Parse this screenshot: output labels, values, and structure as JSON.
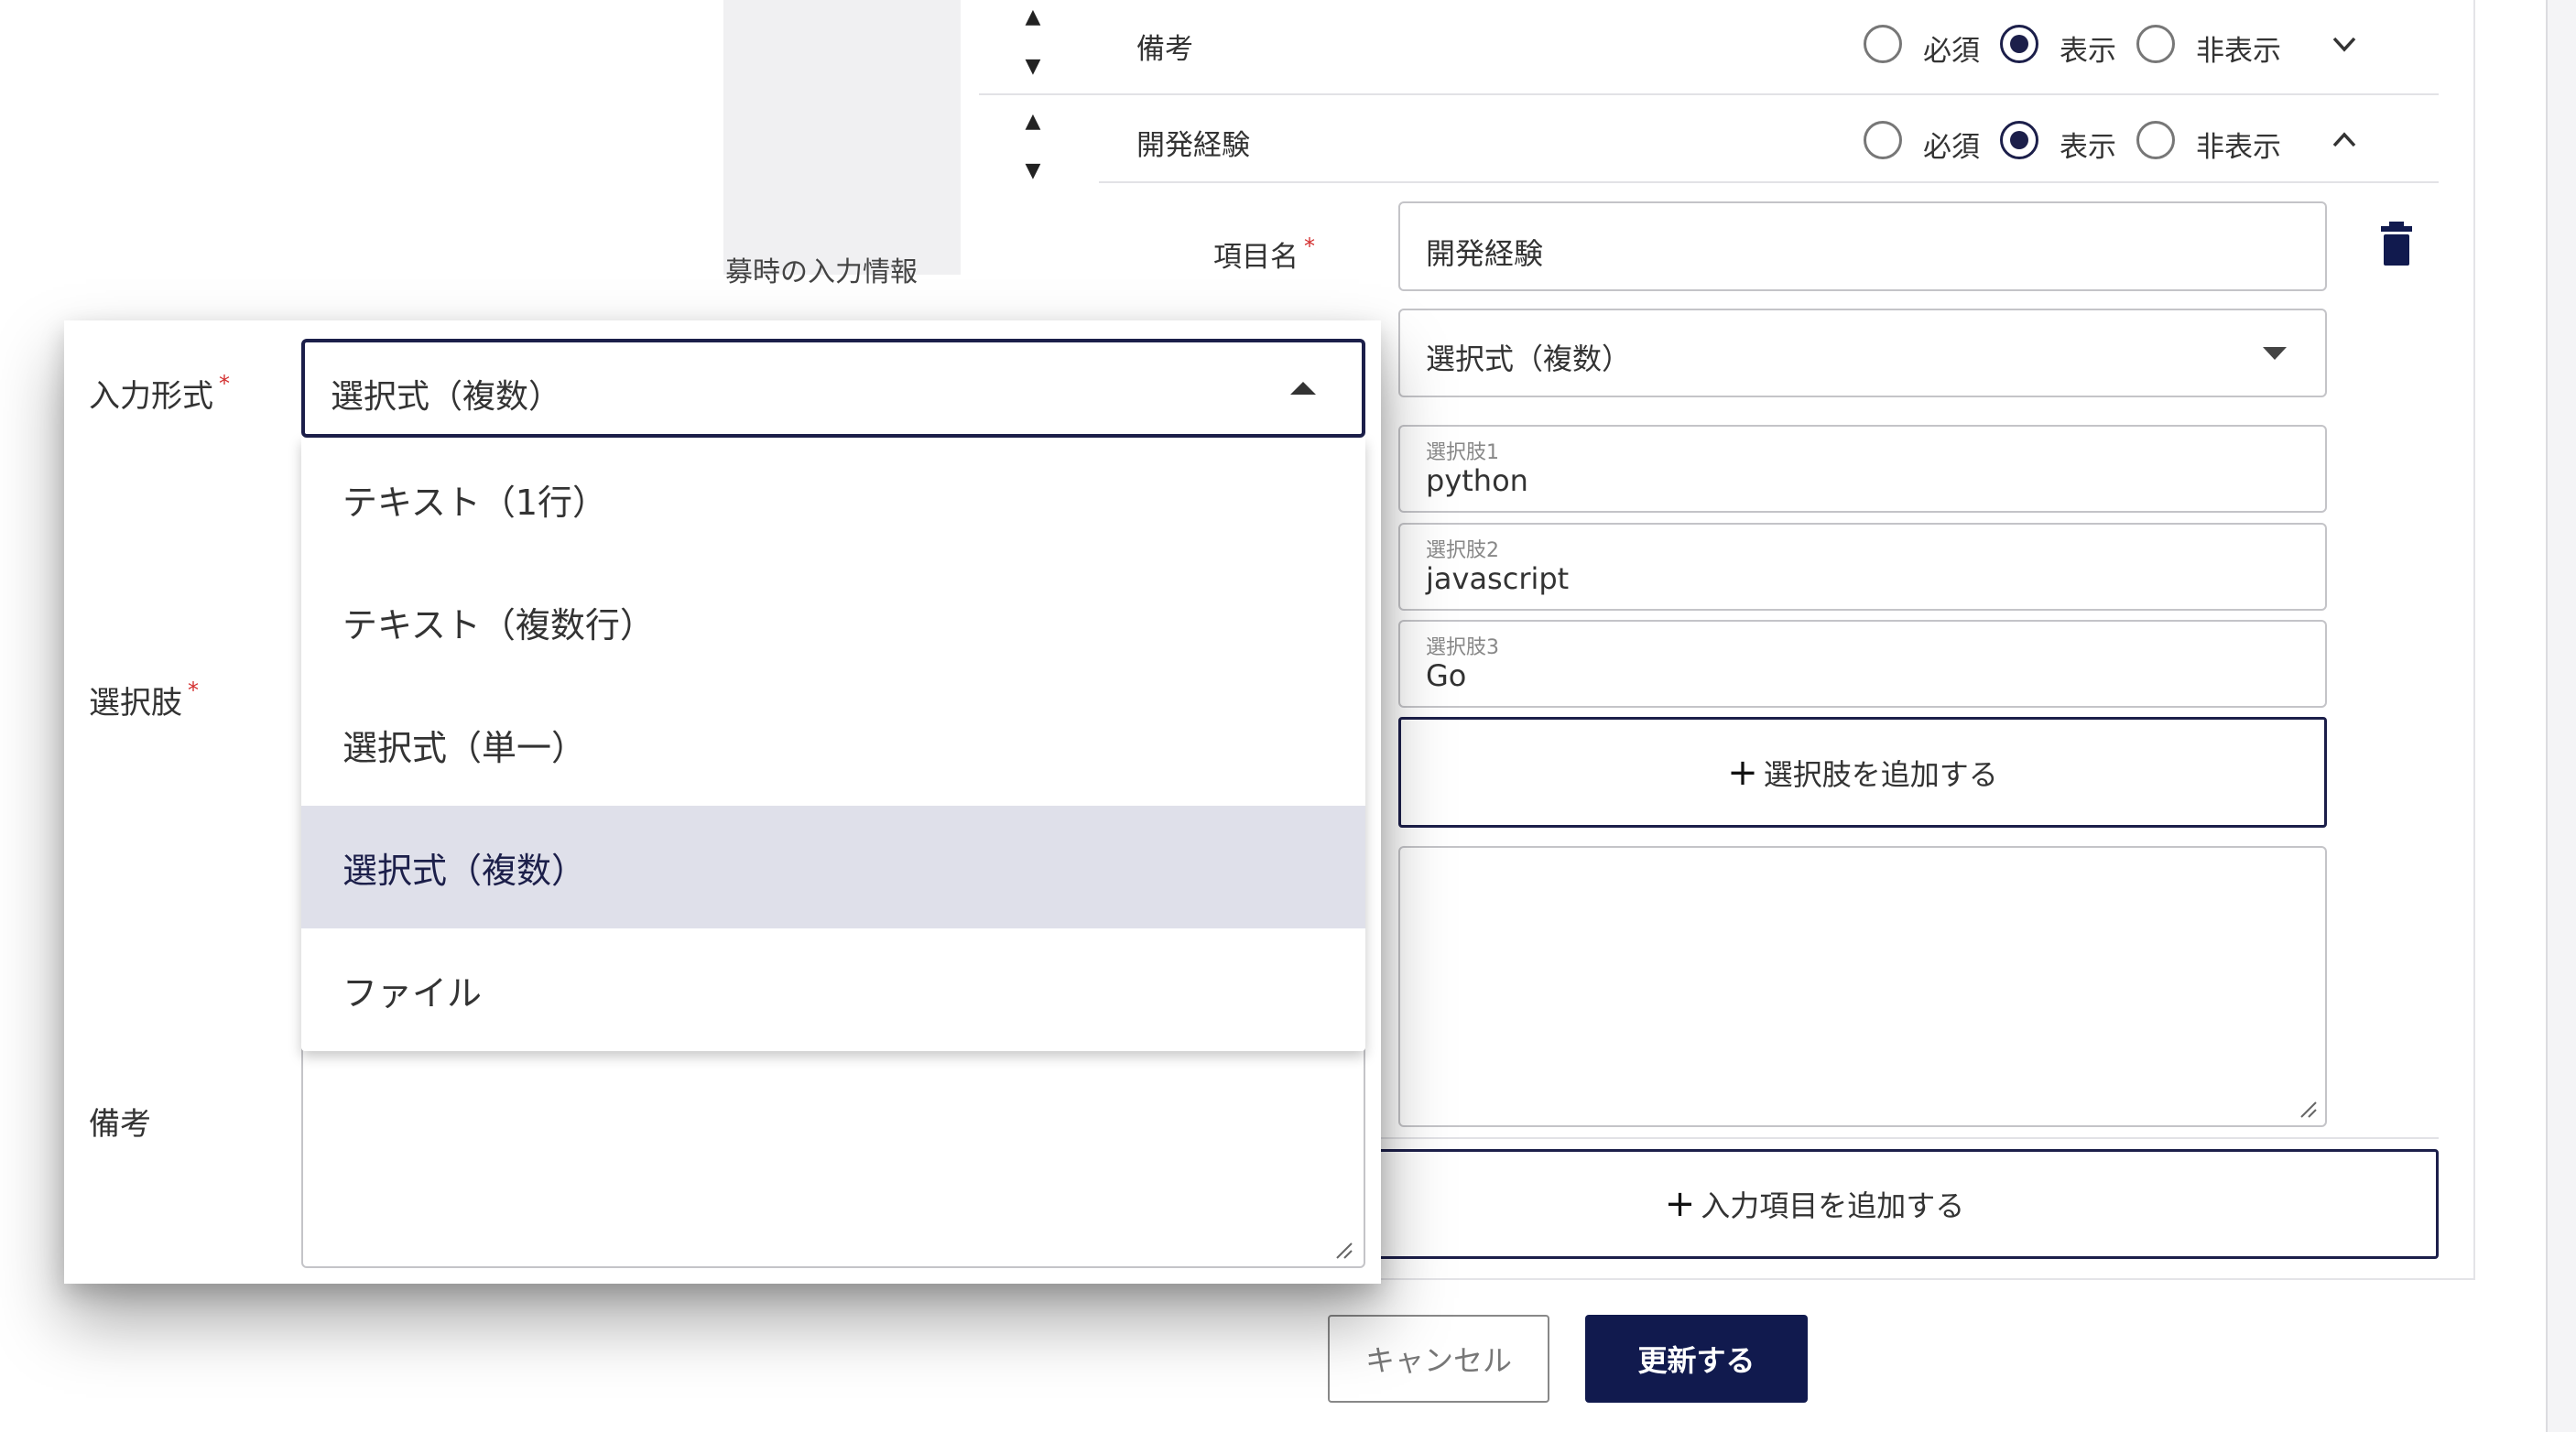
{
  "section": {
    "label": "募時の入力情報"
  },
  "fields": [
    {
      "name": "備考",
      "options": [
        "必須",
        "表示",
        "非表示"
      ],
      "selected": "表示",
      "expanded": false
    },
    {
      "name": "開発経験",
      "options": [
        "必須",
        "表示",
        "非表示"
      ],
      "selected": "表示",
      "expanded": true
    }
  ],
  "detail": {
    "item_name_label": "項目名",
    "item_name_value": "開発経験",
    "input_type_value": "選択式（複数）",
    "choices": [
      {
        "float_label": "選択肢1",
        "value": "python"
      },
      {
        "float_label": "選択肢2",
        "value": "javascript"
      },
      {
        "float_label": "選択肢3",
        "value": "Go"
      }
    ],
    "add_choice_label": "選択肢を追加する"
  },
  "add_field_label": "入力項目を追加する",
  "actions": {
    "cancel": "キャンセル",
    "update": "更新する"
  },
  "modal": {
    "input_type_label": "入力形式",
    "choices_label": "選択肢",
    "notes_label": "備考",
    "select_value": "選択式（複数）",
    "options": [
      "テキスト（1行）",
      "テキスト（複数行）",
      "選択式（単一）",
      "選択式（複数）",
      "ファイル"
    ],
    "selected_option": "選択式（複数）"
  },
  "required_mark": "*",
  "plus_symbol": "+",
  "colors": {
    "primary": "#1c1f4a",
    "required": "#d32f2f",
    "selected_bg": "#dfe0ea"
  },
  "icons": [
    "arrow-up-icon",
    "arrow-down-icon",
    "chevron-down-icon",
    "chevron-up-icon",
    "trash-icon",
    "dropdown-arrow-icon",
    "plus-icon",
    "resize-handle-icon"
  ]
}
